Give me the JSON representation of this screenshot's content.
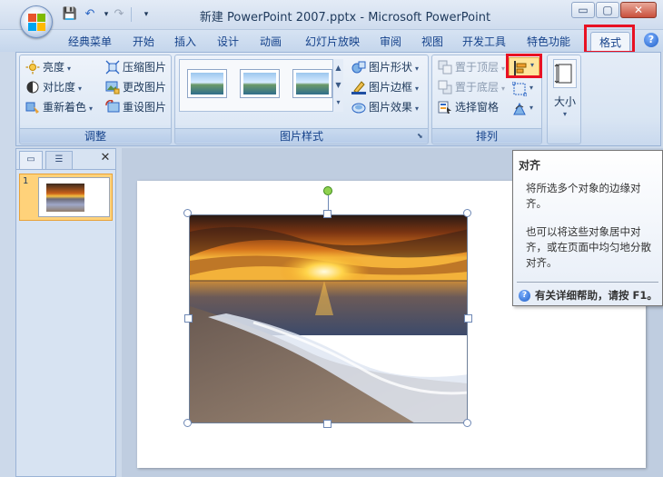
{
  "window": {
    "title": "新建 PowerPoint 2007.pptx - Microsoft PowerPoint",
    "controls": {
      "minimize": "▭",
      "maximize": "▢",
      "close": "✕"
    }
  },
  "qat": {
    "save": "💾",
    "undo": "↶",
    "redo": "↷",
    "customize": "▾"
  },
  "tabs": [
    {
      "label": "经典菜单"
    },
    {
      "label": "开始"
    },
    {
      "label": "插入"
    },
    {
      "label": "设计"
    },
    {
      "label": "动画"
    },
    {
      "label": "幻灯片放映"
    },
    {
      "label": "审阅"
    },
    {
      "label": "视图"
    },
    {
      "label": "开发工具"
    },
    {
      "label": "特色功能"
    },
    {
      "label": "格式",
      "active": true
    }
  ],
  "help_glyph": "?",
  "ribbon": {
    "adjust": {
      "label": "调整",
      "items": [
        "亮度",
        "对比度",
        "重新着色",
        "压缩图片",
        "更改图片",
        "重设图片"
      ]
    },
    "picture_styles": {
      "label": "图片样式",
      "items": [
        "图片形状",
        "图片边框",
        "图片效果"
      ]
    },
    "arrange": {
      "label": "排列",
      "items": [
        "置于顶层",
        "置于底层",
        "选择窗格"
      ]
    },
    "size": {
      "label": "大小"
    }
  },
  "tooltip": {
    "title": "对齐",
    "body1": "将所选多个对象的边缘对齐。",
    "body2": "也可以将这些对象居中对齐，或在页面中均匀地分散对齐。",
    "help": "有关详细帮助，请按 F1。"
  },
  "left_pane": {
    "close": "✕",
    "slide_number": "1"
  },
  "colors": {
    "accent": "#15428b",
    "highlight": "#e81123"
  }
}
